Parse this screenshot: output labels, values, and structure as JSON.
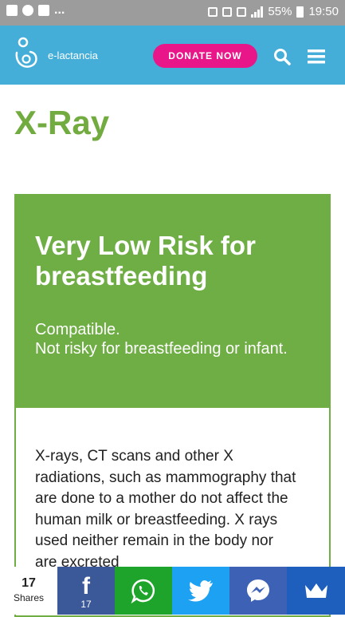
{
  "status_bar": {
    "battery": "55%",
    "time": "19:50",
    "overflow": "..."
  },
  "header": {
    "brand": "e-lactancia",
    "donate_label": "DONATE NOW"
  },
  "page": {
    "title": "X-Ray"
  },
  "risk": {
    "heading": "Very Low Risk for breastfeeding",
    "compat_line1": "Compatible.",
    "compat_line2": "Not risky for breastfeeding or infant.",
    "description": "X-rays, CT scans and other X radiations, such as mammography that are done to a mother do not affect the human milk or breastfeeding. X rays used neither remain in the body nor are excreted",
    "color": "#6fad45"
  },
  "share": {
    "count": "17",
    "label": "Shares",
    "facebook_count": "17",
    "buttons": [
      "facebook-icon",
      "whatsapp-icon",
      "twitter-icon",
      "messenger-icon",
      "crown-icon"
    ]
  },
  "colors": {
    "header": "#45aed8",
    "donate": "#e9168a",
    "title": "#72ab3f",
    "statusbar": "#9c9c9c"
  }
}
